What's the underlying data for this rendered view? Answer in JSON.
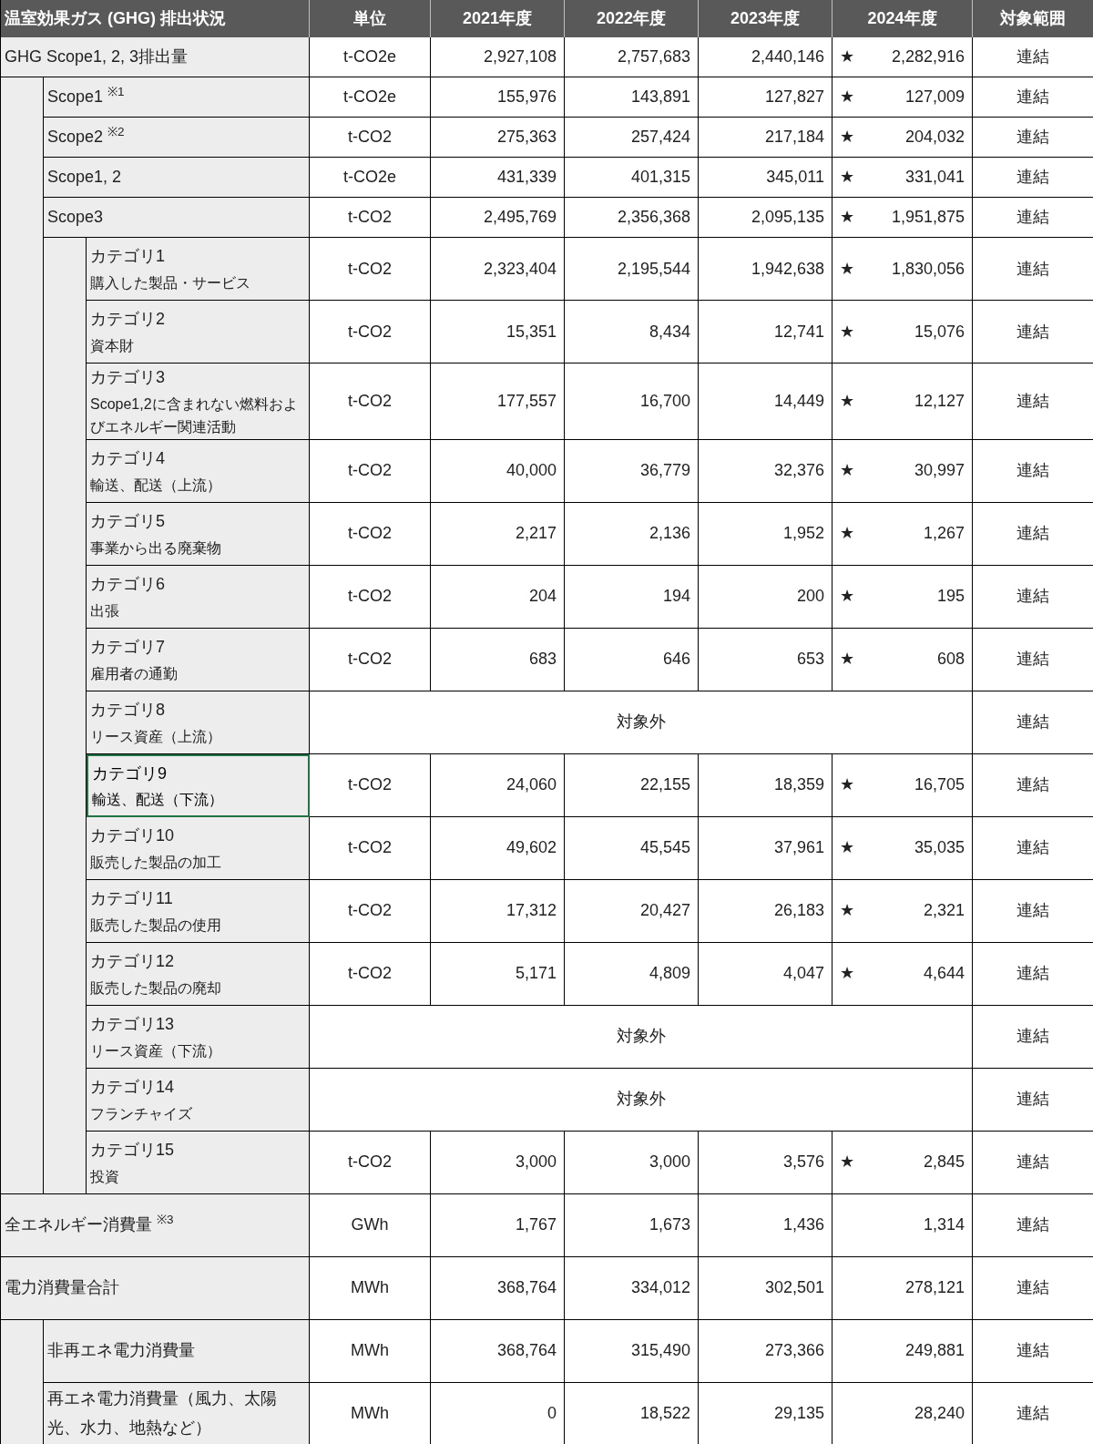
{
  "header": [
    "温室効果ガス (GHG) 排出状況",
    "単位",
    "2021年度",
    "2022年度",
    "2023年度",
    "2024年度",
    "対象範囲"
  ],
  "sections": [
    {
      "kind": "emissions",
      "rows": [
        {
          "label": "GHG Scope1, 2, 3排出量",
          "unit": "t-CO2e",
          "values": [
            "2,927,108",
            "2,757,683",
            "2,440,146",
            "2,282,916"
          ],
          "mark": "★",
          "scope": "連結",
          "selected": false,
          "children": [
            {
              "label": "Scope1 $^{※1}$",
              "unit": "t-CO2e",
              "values": [
                "155,976",
                "143,891",
                "127,827",
                "127,009"
              ],
              "mark": "★",
              "scope": "連結",
              "selected": false
            },
            {
              "label": "Scope2 $^{※2}$",
              "unit": "t-CO2",
              "values": [
                "275,363",
                "257,424",
                "217,184",
                "204,032"
              ],
              "mark": "★",
              "scope": "連結",
              "selected": false
            },
            {
              "label": "Scope1, 2",
              "unit": "t-CO2e",
              "values": [
                "431,339",
                "401,315",
                "345,011",
                "331,041"
              ],
              "mark": "★",
              "scope": "連結",
              "selected": false
            },
            {
              "label": "Scope3",
              "unit": "t-CO2",
              "values": [
                "2,495,769",
                "2,356,368",
                "2,095,135",
                "1,951,875"
              ],
              "mark": "★",
              "scope": "連結",
              "selected": false,
              "children": [
                {
                  "label": "カテゴリ1",
                  "sub": "購入した製品・サービス",
                  "unit": "t-CO2",
                  "values": [
                    "2,323,404",
                    "2,195,544",
                    "1,942,638",
                    "1,830,056"
                  ],
                  "mark": "★",
                  "scope": "連結",
                  "selected": false
                },
                {
                  "label": "カテゴリ2",
                  "sub": "資本財",
                  "unit": "t-CO2",
                  "values": [
                    "15,351",
                    "8,434",
                    "12,741",
                    "15,076"
                  ],
                  "mark": "★",
                  "scope": "連結",
                  "selected": false
                },
                {
                  "label": "カテゴリ3",
                  "sub": "Scope1,2に含まれない燃料およびエネルギー関連活動",
                  "unit": "t-CO2",
                  "values": [
                    "177,557",
                    "16,700",
                    "14,449",
                    "12,127"
                  ],
                  "mark": "★",
                  "scope": "連結",
                  "selected": false
                },
                {
                  "label": "カテゴリ4",
                  "sub": "輸送、配送（上流）",
                  "unit": "t-CO2",
                  "values": [
                    "40,000",
                    "36,779",
                    "32,376",
                    "30,997"
                  ],
                  "mark": "★",
                  "scope": "連結",
                  "selected": false
                },
                {
                  "label": "カテゴリ5",
                  "sub": "事業から出る廃棄物",
                  "unit": "t-CO2",
                  "values": [
                    "2,217",
                    "2,136",
                    "1,952",
                    "1,267"
                  ],
                  "mark": "★",
                  "scope": "連結",
                  "selected": false
                },
                {
                  "label": "カテゴリ6",
                  "sub": "出張",
                  "unit": "t-CO2",
                  "values": [
                    "204",
                    "194",
                    "200",
                    "195"
                  ],
                  "mark": "★",
                  "scope": "連結",
                  "selected": false
                },
                {
                  "label": "カテゴリ7",
                  "sub": "雇用者の通勤",
                  "unit": "t-CO2",
                  "values": [
                    "683",
                    "646",
                    "653",
                    "608"
                  ],
                  "mark": "★",
                  "scope": "連結",
                  "selected": false
                },
                {
                  "label": "カテゴリ8",
                  "sub": "リース資産（上流）",
                  "note": "対象外",
                  "scope": "連結",
                  "selected": false
                },
                {
                  "label": "カテゴリ9",
                  "sub": "輸送、配送（下流）",
                  "unit": "t-CO2",
                  "values": [
                    "24,060",
                    "22,155",
                    "18,359",
                    "16,705"
                  ],
                  "mark": "★",
                  "scope": "連結",
                  "selected": true
                },
                {
                  "label": "カテゴリ10",
                  "sub": "販売した製品の加工",
                  "unit": "t-CO2",
                  "values": [
                    "49,602",
                    "45,545",
                    "37,961",
                    "35,035"
                  ],
                  "mark": "★",
                  "scope": "連結",
                  "selected": false
                },
                {
                  "label": "カテゴリ11",
                  "sub": "販売した製品の使用",
                  "unit": "t-CO2",
                  "values": [
                    "17,312",
                    "20,427",
                    "26,183",
                    "2,321"
                  ],
                  "mark": "★",
                  "scope": "連結",
                  "selected": false
                },
                {
                  "label": "カテゴリ12",
                  "sub": "販売した製品の廃却",
                  "unit": "t-CO2",
                  "values": [
                    "5,171",
                    "4,809",
                    "4,047",
                    "4,644"
                  ],
                  "mark": "★",
                  "scope": "連結",
                  "selected": false
                },
                {
                  "label": "カテゴリ13",
                  "sub": "リース資産（下流）",
                  "note": "対象外",
                  "scope": "連結",
                  "selected": false
                },
                {
                  "label": "カテゴリ14",
                  "sub": "フランチャイズ",
                  "note": "対象外",
                  "scope": "連結",
                  "selected": false
                },
                {
                  "label": "カテゴリ15",
                  "sub": "投資",
                  "unit": "t-CO2",
                  "values": [
                    "3,000",
                    "3,000",
                    "3,576",
                    "2,845"
                  ],
                  "mark": "★",
                  "scope": "連結",
                  "selected": false
                }
              ]
            }
          ]
        }
      ]
    },
    {
      "kind": "energy",
      "rows": [
        {
          "label": "全エネルギー消費量 $^{※3}$",
          "unit": "GWh",
          "values": [
            "1,767",
            "1,673",
            "1,436",
            "1,314"
          ],
          "scope": "連結",
          "selected": false
        },
        {
          "label": "電力消費量合計",
          "unit": "MWh",
          "values": [
            "368,764",
            "334,012",
            "302,501",
            "278,121"
          ],
          "scope": "連結",
          "selected": false,
          "children": [
            {
              "label": "非再エネ電力消費量",
              "unit": "MWh",
              "values": [
                "368,764",
                "315,490",
                "273,366",
                "249,881"
              ],
              "scope": "連結",
              "selected": false
            },
            {
              "label": "再エネ電力消費量（風力、太陽光、水力、地熱など）",
              "unit": "MWh",
              "values": [
                "0",
                "18,522",
                "29,135",
                "28,240"
              ],
              "scope": "連結",
              "selected": false
            }
          ]
        }
      ]
    }
  ]
}
